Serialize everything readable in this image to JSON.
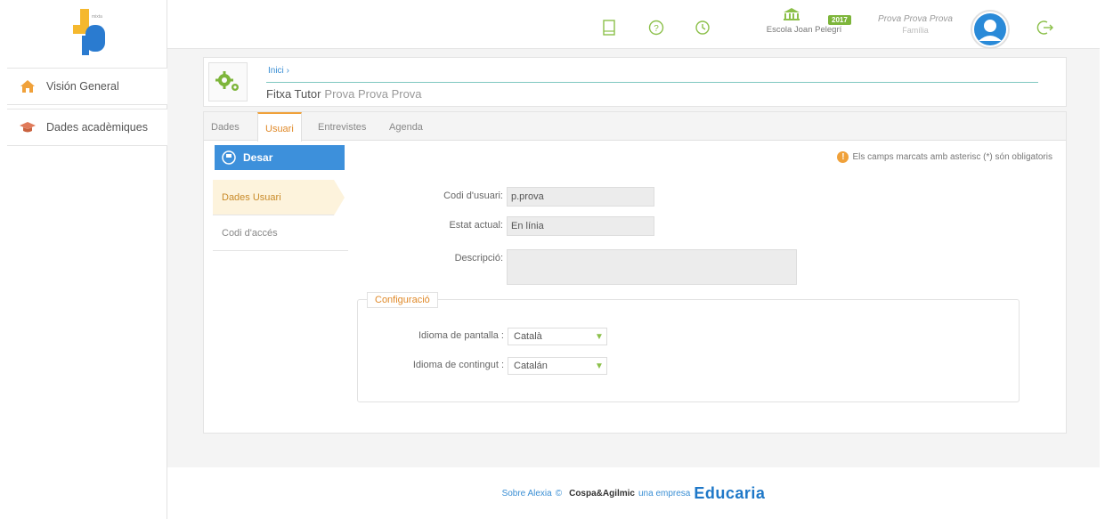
{
  "sidebar": {
    "logo_text": "JP",
    "items": [
      {
        "label": "Visión General"
      },
      {
        "label": "Dades acadèmiques"
      }
    ]
  },
  "topbar": {
    "school": "Escola Joan Pelegrí",
    "year": "2017",
    "user_name": "Prova Prova Prova",
    "user_role": "Família",
    "icons": [
      "notebook-icon",
      "help-icon",
      "history-icon",
      "school-building-icon",
      "user-avatar-icon",
      "logout-icon"
    ]
  },
  "header": {
    "breadcrumb": "Inici",
    "title": "Fitxa Tutor",
    "subtitle": "Prova Prova Prova"
  },
  "tabs": [
    {
      "label": "Dades"
    },
    {
      "label": "Usuari"
    },
    {
      "label": "Entrevistes"
    },
    {
      "label": "Agenda"
    }
  ],
  "save_label": "Desar",
  "required_note": "Els camps marcats amb asterisc (*) són obligatoris",
  "subnav": [
    {
      "label": "Dades Usuari"
    },
    {
      "label": "Codi d'accés"
    }
  ],
  "form": {
    "user_code_label": "Codi d'usuari:",
    "user_code_value": "p.prova",
    "status_label": "Estat actual:",
    "status_value": "En línia",
    "description_label": "Descripció:",
    "description_value": ""
  },
  "config": {
    "legend": "Configuració",
    "screen_lang_label": "Idioma de pantalla :",
    "screen_lang_value": "Català",
    "content_lang_label": "Idioma de contingut :",
    "content_lang_value": "Catalán"
  },
  "footer": {
    "about": "Sobre Alexia",
    "copyright": "©",
    "company": "Cospa&Agilmic",
    "tagline": "una empresa",
    "brand": "Educaria"
  },
  "colors": {
    "accent_blue": "#3d90db",
    "accent_orange": "#f0a13a",
    "accent_green": "#7db53a"
  }
}
